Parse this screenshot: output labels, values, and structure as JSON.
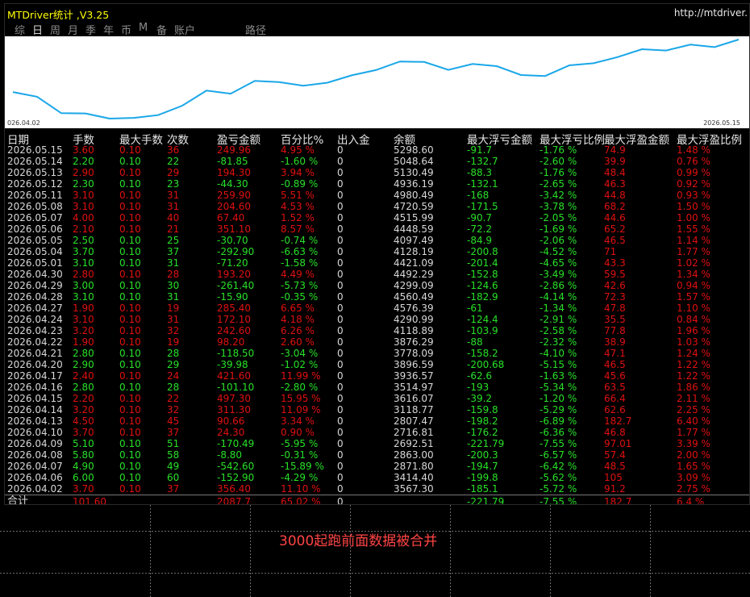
{
  "window": {
    "title": "MTDriver统计 ,V3.25",
    "url": "http://mtdriver."
  },
  "tabs": [
    {
      "label": "综",
      "active": false
    },
    {
      "label": "日",
      "active": true
    },
    {
      "label": "周",
      "active": false
    },
    {
      "label": "月",
      "active": false
    },
    {
      "label": "季",
      "active": false
    },
    {
      "label": "年",
      "active": false
    },
    {
      "label": "币",
      "active": false
    },
    {
      "label": "M",
      "active": false
    },
    {
      "label": "备",
      "active": false
    },
    {
      "label": "账户",
      "active": false
    },
    {
      "label": "路径",
      "active": false
    }
  ],
  "chart_data": {
    "type": "line",
    "x_start_label": "026.04.02",
    "x_end_label": "2026.05.15",
    "line_color": "#1aa7e8",
    "x": [
      "2026.04.02",
      "2026.04.06",
      "2026.04.07",
      "2026.04.08",
      "2026.04.09",
      "2026.04.10",
      "2026.04.13",
      "2026.04.14",
      "2026.04.15",
      "2026.04.16",
      "2026.04.17",
      "2026.04.20",
      "2026.04.21",
      "2026.04.22",
      "2026.04.23",
      "2026.04.24",
      "2026.04.27",
      "2026.04.28",
      "2026.04.29",
      "2026.04.30",
      "2026.05.01",
      "2026.05.04",
      "2026.05.05",
      "2026.05.06",
      "2026.05.07",
      "2026.05.08",
      "2026.05.11",
      "2026.05.12",
      "2026.05.13",
      "2026.05.14",
      "2026.05.15"
    ],
    "values": [
      3567.3,
      3414.4,
      2871.8,
      2863.0,
      2692.51,
      2716.81,
      2807.47,
      3118.77,
      3616.07,
      3514.97,
      3936.57,
      3896.59,
      3778.09,
      3876.29,
      4118.89,
      4290.99,
      4576.39,
      4560.49,
      4299.09,
      4492.29,
      4421.09,
      4128.19,
      4097.49,
      4448.59,
      4515.99,
      4720.59,
      4980.49,
      4936.19,
      5130.49,
      5048.64,
      5298.6
    ]
  },
  "columns": [
    "日期",
    "手数",
    "最大手数",
    "次数",
    "盈亏金额",
    "百分比%",
    "出入金",
    "余额",
    "最大浮亏金额",
    "最大浮亏比例",
    "最大浮盈金额",
    "最大浮盈比例"
  ],
  "rows": [
    {
      "date": "2026.05.15",
      "lots": "3.60",
      "max_lots": "0.10",
      "count": "36",
      "pnl": "249.96",
      "pct": "4.95 %",
      "io": "0",
      "balance": "5298.60",
      "max_loss": "-91.7",
      "max_loss_pct": "-1.76 %",
      "max_gain": "74.9",
      "max_gain_pct": "1.48 %",
      "pos": true
    },
    {
      "date": "2026.05.14",
      "lots": "2.20",
      "max_lots": "0.10",
      "count": "22",
      "pnl": "-81.85",
      "pct": "-1.60 %",
      "io": "0",
      "balance": "5048.64",
      "max_loss": "-132.7",
      "max_loss_pct": "-2.60 %",
      "max_gain": "39.9",
      "max_gain_pct": "0.76 %",
      "pos": false
    },
    {
      "date": "2026.05.13",
      "lots": "2.90",
      "max_lots": "0.10",
      "count": "29",
      "pnl": "194.30",
      "pct": "3.94 %",
      "io": "0",
      "balance": "5130.49",
      "max_loss": "-88.3",
      "max_loss_pct": "-1.76 %",
      "max_gain": "48.4",
      "max_gain_pct": "0.99 %",
      "pos": true
    },
    {
      "date": "2026.05.12",
      "lots": "2.30",
      "max_lots": "0.10",
      "count": "23",
      "pnl": "-44.30",
      "pct": "-0.89 %",
      "io": "0",
      "balance": "4936.19",
      "max_loss": "-132.1",
      "max_loss_pct": "-2.65 %",
      "max_gain": "46.3",
      "max_gain_pct": "0.92 %",
      "pos": false
    },
    {
      "date": "2026.05.11",
      "lots": "3.10",
      "max_lots": "0.10",
      "count": "31",
      "pnl": "259.90",
      "pct": "5.51 %",
      "io": "0",
      "balance": "4980.49",
      "max_loss": "-168",
      "max_loss_pct": "-3.42 %",
      "max_gain": "44.8",
      "max_gain_pct": "0.93 %",
      "pos": true
    },
    {
      "date": "2026.05.08",
      "lots": "3.10",
      "max_lots": "0.10",
      "count": "31",
      "pnl": "204.60",
      "pct": "4.53 %",
      "io": "0",
      "balance": "4720.59",
      "max_loss": "-171.5",
      "max_loss_pct": "-3.78 %",
      "max_gain": "68.2",
      "max_gain_pct": "1.50 %",
      "pos": true
    },
    {
      "date": "2026.05.07",
      "lots": "4.00",
      "max_lots": "0.10",
      "count": "40",
      "pnl": "67.40",
      "pct": "1.52 %",
      "io": "0",
      "balance": "4515.99",
      "max_loss": "-90.7",
      "max_loss_pct": "-2.05 %",
      "max_gain": "44.6",
      "max_gain_pct": "1.00 %",
      "pos": true
    },
    {
      "date": "2026.05.06",
      "lots": "2.10",
      "max_lots": "0.10",
      "count": "21",
      "pnl": "351.10",
      "pct": "8.57 %",
      "io": "0",
      "balance": "4448.59",
      "max_loss": "-72.2",
      "max_loss_pct": "-1.69 %",
      "max_gain": "65.2",
      "max_gain_pct": "1.55 %",
      "pos": true
    },
    {
      "date": "2026.05.05",
      "lots": "2.50",
      "max_lots": "0.10",
      "count": "25",
      "pnl": "-30.70",
      "pct": "-0.74 %",
      "io": "0",
      "balance": "4097.49",
      "max_loss": "-84.9",
      "max_loss_pct": "-2.06 %",
      "max_gain": "46.5",
      "max_gain_pct": "1.14 %",
      "pos": false
    },
    {
      "date": "2026.05.04",
      "lots": "3.70",
      "max_lots": "0.10",
      "count": "37",
      "pnl": "-292.90",
      "pct": "-6.63 %",
      "io": "0",
      "balance": "4128.19",
      "max_loss": "-200.8",
      "max_loss_pct": "-4.52 %",
      "max_gain": "71",
      "max_gain_pct": "1.77 %",
      "pos": false
    },
    {
      "date": "2026.05.01",
      "lots": "3.10",
      "max_lots": "0.10",
      "count": "31",
      "pnl": "-71.20",
      "pct": "-1.58 %",
      "io": "0",
      "balance": "4421.09",
      "max_loss": "-201.4",
      "max_loss_pct": "-4.65 %",
      "max_gain": "43.3",
      "max_gain_pct": "1.02 %",
      "pos": false
    },
    {
      "date": "2026.04.30",
      "lots": "2.80",
      "max_lots": "0.10",
      "count": "28",
      "pnl": "193.20",
      "pct": "4.49 %",
      "io": "0",
      "balance": "4492.29",
      "max_loss": "-152.8",
      "max_loss_pct": "-3.49 %",
      "max_gain": "59.5",
      "max_gain_pct": "1.34 %",
      "pos": true
    },
    {
      "date": "2026.04.29",
      "lots": "3.00",
      "max_lots": "0.10",
      "count": "30",
      "pnl": "-261.40",
      "pct": "-5.73 %",
      "io": "0",
      "balance": "4299.09",
      "max_loss": "-124.6",
      "max_loss_pct": "-2.86 %",
      "max_gain": "42.6",
      "max_gain_pct": "0.94 %",
      "pos": false
    },
    {
      "date": "2026.04.28",
      "lots": "3.10",
      "max_lots": "0.10",
      "count": "31",
      "pnl": "-15.90",
      "pct": "-0.35 %",
      "io": "0",
      "balance": "4560.49",
      "max_loss": "-182.9",
      "max_loss_pct": "-4.14 %",
      "max_gain": "72.3",
      "max_gain_pct": "1.57 %",
      "pos": false
    },
    {
      "date": "2026.04.27",
      "lots": "1.90",
      "max_lots": "0.10",
      "count": "19",
      "pnl": "285.40",
      "pct": "6.65 %",
      "io": "0",
      "balance": "4576.39",
      "max_loss": "-61",
      "max_loss_pct": "-1.34 %",
      "max_gain": "47.8",
      "max_gain_pct": "1.10 %",
      "pos": true
    },
    {
      "date": "2026.04.24",
      "lots": "3.10",
      "max_lots": "0.10",
      "count": "31",
      "pnl": "172.10",
      "pct": "4.18 %",
      "io": "0",
      "balance": "4290.99",
      "max_loss": "-124.4",
      "max_loss_pct": "-2.91 %",
      "max_gain": "35.5",
      "max_gain_pct": "0.84 %",
      "pos": true
    },
    {
      "date": "2026.04.23",
      "lots": "3.20",
      "max_lots": "0.10",
      "count": "32",
      "pnl": "242.60",
      "pct": "6.26 %",
      "io": "0",
      "balance": "4118.89",
      "max_loss": "-103.9",
      "max_loss_pct": "-2.58 %",
      "max_gain": "77.8",
      "max_gain_pct": "1.96 %",
      "pos": true
    },
    {
      "date": "2026.04.22",
      "lots": "1.90",
      "max_lots": "0.10",
      "count": "19",
      "pnl": "98.20",
      "pct": "2.60 %",
      "io": "0",
      "balance": "3876.29",
      "max_loss": "-88",
      "max_loss_pct": "-2.32 %",
      "max_gain": "38.9",
      "max_gain_pct": "1.03 %",
      "pos": true
    },
    {
      "date": "2026.04.21",
      "lots": "2.80",
      "max_lots": "0.10",
      "count": "28",
      "pnl": "-118.50",
      "pct": "-3.04 %",
      "io": "0",
      "balance": "3778.09",
      "max_loss": "-158.2",
      "max_loss_pct": "-4.10 %",
      "max_gain": "47.1",
      "max_gain_pct": "1.24 %",
      "pos": false
    },
    {
      "date": "2026.04.20",
      "lots": "2.90",
      "max_lots": "0.10",
      "count": "29",
      "pnl": "-39.98",
      "pct": "-1.02 %",
      "io": "0",
      "balance": "3896.59",
      "max_loss": "-200.68",
      "max_loss_pct": "-5.15 %",
      "max_gain": "46.5",
      "max_gain_pct": "1.22 %",
      "pos": false
    },
    {
      "date": "2026.04.17",
      "lots": "2.40",
      "max_lots": "0.10",
      "count": "24",
      "pnl": "421.60",
      "pct": "11.99 %",
      "io": "0",
      "balance": "3936.57",
      "max_loss": "-62.6",
      "max_loss_pct": "-1.63 %",
      "max_gain": "45.6",
      "max_gain_pct": "1.22 %",
      "pos": true
    },
    {
      "date": "2026.04.16",
      "lots": "2.80",
      "max_lots": "0.10",
      "count": "28",
      "pnl": "-101.10",
      "pct": "-2.80 %",
      "io": "0",
      "balance": "3514.97",
      "max_loss": "-193",
      "max_loss_pct": "-5.34 %",
      "max_gain": "63.5",
      "max_gain_pct": "1.86 %",
      "pos": false
    },
    {
      "date": "2026.04.15",
      "lots": "2.20",
      "max_lots": "0.10",
      "count": "22",
      "pnl": "497.30",
      "pct": "15.95 %",
      "io": "0",
      "balance": "3616.07",
      "max_loss": "-39.2",
      "max_loss_pct": "-1.20 %",
      "max_gain": "66.4",
      "max_gain_pct": "2.11 %",
      "pos": true
    },
    {
      "date": "2026.04.14",
      "lots": "3.20",
      "max_lots": "0.10",
      "count": "32",
      "pnl": "311.30",
      "pct": "11.09 %",
      "io": "0",
      "balance": "3118.77",
      "max_loss": "-159.8",
      "max_loss_pct": "-5.29 %",
      "max_gain": "62.6",
      "max_gain_pct": "2.25 %",
      "pos": true
    },
    {
      "date": "2026.04.13",
      "lots": "4.50",
      "max_lots": "0.10",
      "count": "45",
      "pnl": "90.66",
      "pct": "3.34 %",
      "io": "0",
      "balance": "2807.47",
      "max_loss": "-198.2",
      "max_loss_pct": "-6.89 %",
      "max_gain": "182.7",
      "max_gain_pct": "6.40 %",
      "pos": true
    },
    {
      "date": "2026.04.10",
      "lots": "3.70",
      "max_lots": "0.10",
      "count": "37",
      "pnl": "24.30",
      "pct": "0.90 %",
      "io": "0",
      "balance": "2716.81",
      "max_loss": "-176.2",
      "max_loss_pct": "-6.36 %",
      "max_gain": "46.8",
      "max_gain_pct": "1.77 %",
      "pos": true
    },
    {
      "date": "2026.04.09",
      "lots": "5.10",
      "max_lots": "0.10",
      "count": "51",
      "pnl": "-170.49",
      "pct": "-5.95 %",
      "io": "0",
      "balance": "2692.51",
      "max_loss": "-221.79",
      "max_loss_pct": "-7.55 %",
      "max_gain": "97.01",
      "max_gain_pct": "3.39 %",
      "pos": false
    },
    {
      "date": "2026.04.08",
      "lots": "5.80",
      "max_lots": "0.10",
      "count": "58",
      "pnl": "-8.80",
      "pct": "-0.31 %",
      "io": "0",
      "balance": "2863.00",
      "max_loss": "-200.3",
      "max_loss_pct": "-6.57 %",
      "max_gain": "57.4",
      "max_gain_pct": "2.00 %",
      "pos": false
    },
    {
      "date": "2026.04.07",
      "lots": "4.90",
      "max_lots": "0.10",
      "count": "49",
      "pnl": "-542.60",
      "pct": "-15.89 %",
      "io": "0",
      "balance": "2871.80",
      "max_loss": "-194.7",
      "max_loss_pct": "-6.42 %",
      "max_gain": "48.5",
      "max_gain_pct": "1.65 %",
      "pos": false
    },
    {
      "date": "2026.04.06",
      "lots": "6.00",
      "max_lots": "0.10",
      "count": "60",
      "pnl": "-152.90",
      "pct": "-4.29 %",
      "io": "0",
      "balance": "3414.40",
      "max_loss": "-199.8",
      "max_loss_pct": "-5.62 %",
      "max_gain": "105",
      "max_gain_pct": "3.09 %",
      "pos": false
    },
    {
      "date": "2026.04.02",
      "lots": "3.70",
      "max_lots": "0.10",
      "count": "37",
      "pnl": "356.40",
      "pct": "11.10 %",
      "io": "0",
      "balance": "3567.30",
      "max_loss": "-185.1",
      "max_loss_pct": "-5.72 %",
      "max_gain": "91.2",
      "max_gain_pct": "2.75 %",
      "pos": true
    }
  ],
  "totals": {
    "label": "合计",
    "lots": "101.60",
    "pnl": "2087.7",
    "pct": "65.02 %",
    "io": "0",
    "max_loss": "-221.79",
    "max_loss_pct": "-7.55 %",
    "max_gain": "182.7",
    "max_gain_pct": "6.4 %"
  },
  "footer_note": "3000起跑前面数据被合并",
  "colors": {
    "positive": "#e01010",
    "negative": "#28e028",
    "title": "#ffff00",
    "line": "#1aa7e8"
  }
}
